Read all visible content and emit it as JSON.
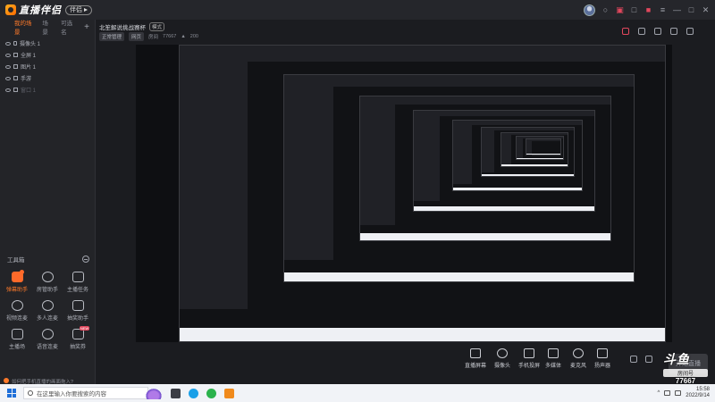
{
  "app": {
    "title": "直播伴侣",
    "version_label": "伴侣"
  },
  "sidebar": {
    "scene_tabs": [
      {
        "label": "我的场景",
        "active": true
      },
      {
        "label": "场景",
        "active": false
      },
      {
        "label": "可选名",
        "active": false
      }
    ],
    "layers": [
      {
        "label": "摄像头 1",
        "visible": true
      },
      {
        "label": "全屏 1",
        "visible": true
      },
      {
        "label": "图片 1",
        "visible": true
      },
      {
        "label": "手游",
        "visible": true
      },
      {
        "label": "窗口 1",
        "visible": false
      }
    ],
    "tools_title": "工具箱",
    "tools": [
      {
        "label": "弹幕助手",
        "active": true,
        "badge": "dot"
      },
      {
        "label": "房管助手",
        "active": false
      },
      {
        "label": "主播任务",
        "active": false
      },
      {
        "label": "视频连麦",
        "active": false
      },
      {
        "label": "多人连麦",
        "active": false
      },
      {
        "label": "抽奖助手",
        "active": false
      },
      {
        "label": "主播场",
        "active": false
      },
      {
        "label": "语音连麦",
        "active": false
      },
      {
        "label": "抽奖券",
        "active": false,
        "badge": "new"
      }
    ],
    "notice": "如何把手机直播的画面拖入?"
  },
  "main": {
    "room_title": "北笙解说挑战赛杯",
    "room_tag": "模式",
    "sub_chip": "正常管理",
    "sub_chip2": "网页",
    "room_label": "房间",
    "room_id": "77667",
    "heat": "200",
    "actions": [
      {
        "label": "直播屏幕"
      },
      {
        "label": "摄像头"
      },
      {
        "label": "手机投屏"
      },
      {
        "label": "多媒体"
      },
      {
        "label": "麦克风"
      },
      {
        "label": "扬声器"
      }
    ],
    "live_button": "开始直播"
  },
  "watermark": {
    "logo": "斗鱼",
    "room_caption": "房间号",
    "room_number": "77667"
  },
  "taskbar": {
    "search_placeholder": "在这里输入你要搜索的内容",
    "time": "15:58",
    "date": "2022/9/14"
  },
  "colors": {
    "accent": "#ff6a2a",
    "panel": "#232428",
    "bg": "#1b1c20",
    "taskbar": "#f1f3f7"
  }
}
